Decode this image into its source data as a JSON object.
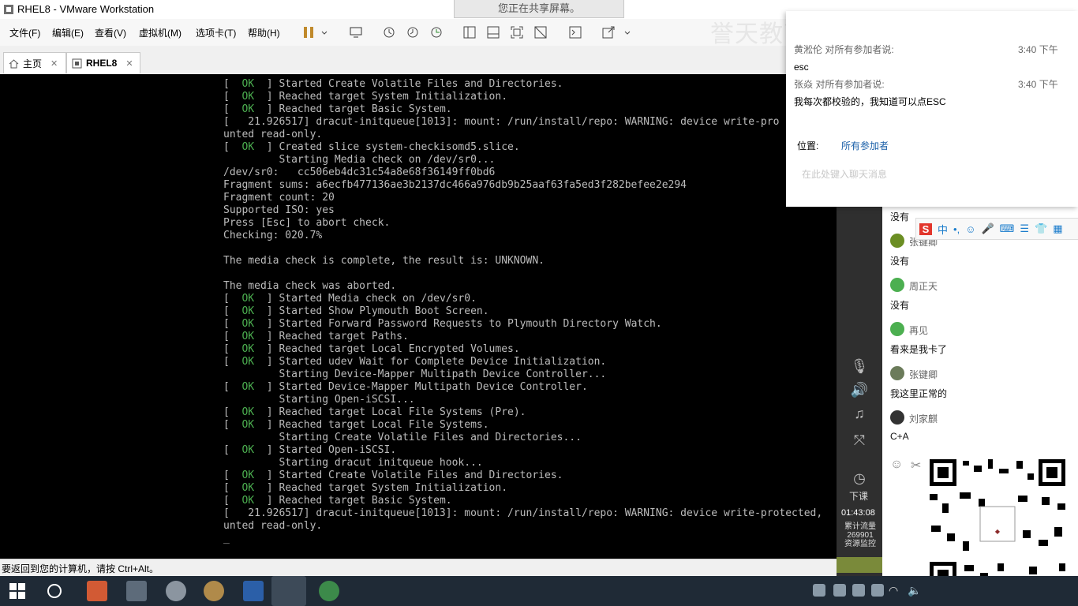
{
  "window": {
    "title": "RHEL8 - VMware Workstation",
    "share_banner": "您正在共享屏幕。"
  },
  "menu": {
    "items": [
      "文件(F)",
      "编辑(E)",
      "查看(V)",
      "虚拟机(M)",
      "选项卡(T)",
      "帮助(H)"
    ]
  },
  "tabs": {
    "home": "主页",
    "vm": "RHEL8"
  },
  "console": {
    "lines": [
      "[  OK  ] Started Create Volatile Files and Directories.",
      "[  OK  ] Reached target System Initialization.",
      "[  OK  ] Reached target Basic System.",
      "[   21.926517] dracut-initqueue[1013]: mount: /run/install/repo: WARNING: device write-pro",
      "unted read-only.",
      "[  OK  ] Created slice system-checkisomd5.slice.",
      "         Starting Media check on /dev/sr0...",
      "/dev/sr0:   cc506eb4dc31c54a8e68f36149ff0bd6",
      "Fragment sums: a6ecfb477136ae3b2137dc466a976db9b25aaf63fa5ed3f282befee2e294",
      "Fragment count: 20",
      "Supported ISO: yes",
      "Press [Esc] to abort check.",
      "Checking: 020.7%",
      "",
      "The media check is complete, the result is: UNKNOWN.",
      "",
      "The media check was aborted.",
      "[  OK  ] Started Media check on /dev/sr0.",
      "[  OK  ] Started Show Plymouth Boot Screen.",
      "[  OK  ] Started Forward Password Requests to Plymouth Directory Watch.",
      "[  OK  ] Reached target Paths.",
      "[  OK  ] Reached target Local Encrypted Volumes.",
      "[  OK  ] Started udev Wait for Complete Device Initialization.",
      "         Starting Device-Mapper Multipath Device Controller...",
      "[  OK  ] Started Device-Mapper Multipath Device Controller.",
      "         Starting Open-iSCSI...",
      "[  OK  ] Reached target Local File Systems (Pre).",
      "[  OK  ] Reached target Local File Systems.",
      "         Starting Create Volatile Files and Directories...",
      "[  OK  ] Started Open-iSCSI.",
      "         Starting dracut initqueue hook...",
      "[  OK  ] Started Create Volatile Files and Directories.",
      "[  OK  ] Reached target System Initialization.",
      "[  OK  ] Reached target Basic System.",
      "[   21.926517] dracut-initqueue[1013]: mount: /run/install/repo: WARNING: device write-protected,",
      "unted read-only.",
      "_"
    ]
  },
  "statusbar": {
    "text": "要返回到您的计算机，请按 Ctrl+Alt。"
  },
  "watermark": "誉天教育 www.yutianedu.com",
  "chat": {
    "popup": {
      "sender1": "黄淞伦 对所有参加者说:",
      "time1": "3:40 下午",
      "msg1": "esc",
      "sender2": "张焱 对所有参加者说:",
      "time2": "3:40 下午",
      "msg2": "我每次都校验的，我知道可以点ESC",
      "location_label": "位置:",
      "location_value": "所有参加者",
      "input_placeholder": "在此处键入聊天消息"
    },
    "messages": [
      {
        "text": "没有"
      },
      {
        "name": "张键卿",
        "text": "没有"
      },
      {
        "name": "周正天",
        "text": "没有"
      },
      {
        "name": "再见",
        "text": "看来是我卡了"
      },
      {
        "name": "张键卿",
        "text": "我这里正常的"
      },
      {
        "name": "刘家麒",
        "text": "C+A"
      }
    ],
    "strip": {
      "end_label": "下课",
      "time": "01:43:08",
      "net_line1": "累计流量",
      "net_line2": "269901",
      "net_line3": "资源监控"
    }
  },
  "ime": {
    "label": "中"
  }
}
